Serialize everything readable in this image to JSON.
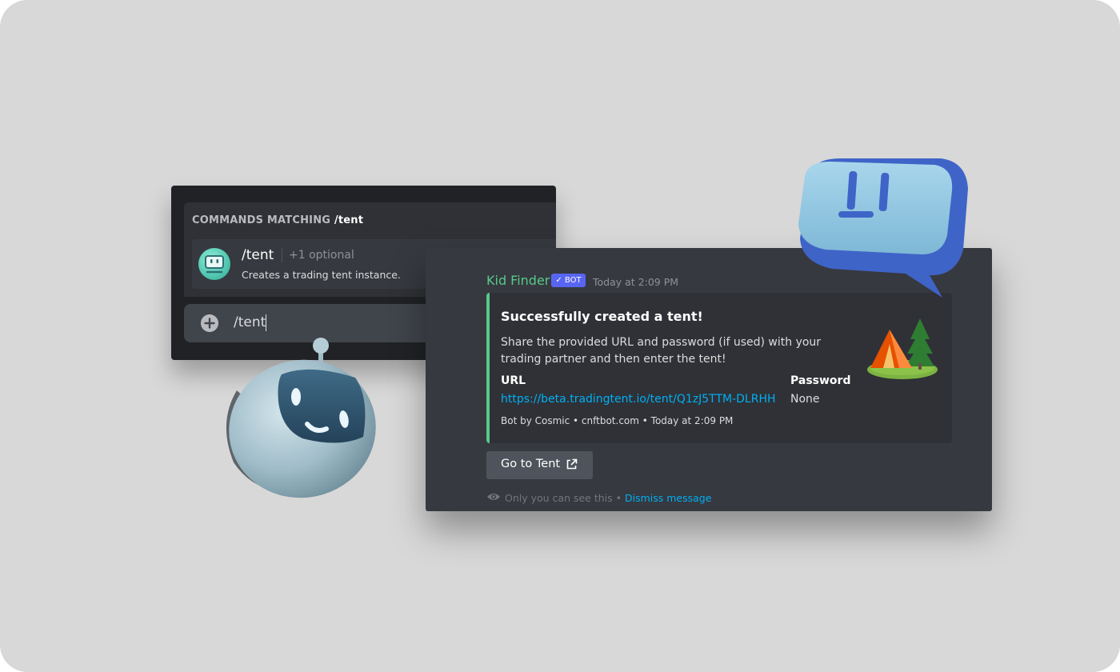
{
  "command_panel": {
    "header_prefix": "COMMANDS MATCHING ",
    "header_query": "/tent",
    "command": {
      "name": "/tent",
      "optional": "+1 optional",
      "description": "Creates a trading tent instance."
    },
    "input_value": "/tent"
  },
  "message": {
    "author": "Kid Finder",
    "bot_tag": "✓ BOT",
    "timestamp": "Today at 2:09 PM",
    "embed": {
      "accent_color": "#57c98a",
      "title": "Successfully created a tent!",
      "description": "Share the provided URL and password (if used) with your trading partner and then enter the tent!",
      "fields": [
        {
          "name": "URL",
          "value": "https://beta.tradingtent.io/tent/Q1zJ5TTM-DLRHH"
        },
        {
          "name": "Password",
          "value": "None"
        }
      ],
      "footer": "Bot by Cosmic • cnftbot.com • Today at 2:09 PM"
    },
    "button_label": "Go to Tent",
    "ephemeral_note": "Only you can see this",
    "separator": " • ",
    "dismiss_label": "Dismiss message"
  },
  "colors": {
    "bot_name": "#57c98a",
    "bot_tag": "#5865f2",
    "link": "#00aff4",
    "panel_dark": "#202225",
    "message_bg": "#36393f"
  },
  "icons": [
    "plus-icon",
    "bot-avatar-icon",
    "external-link-icon",
    "eye-icon",
    "tent-icon",
    "robot-icon",
    "chat-bubble-icon"
  ]
}
